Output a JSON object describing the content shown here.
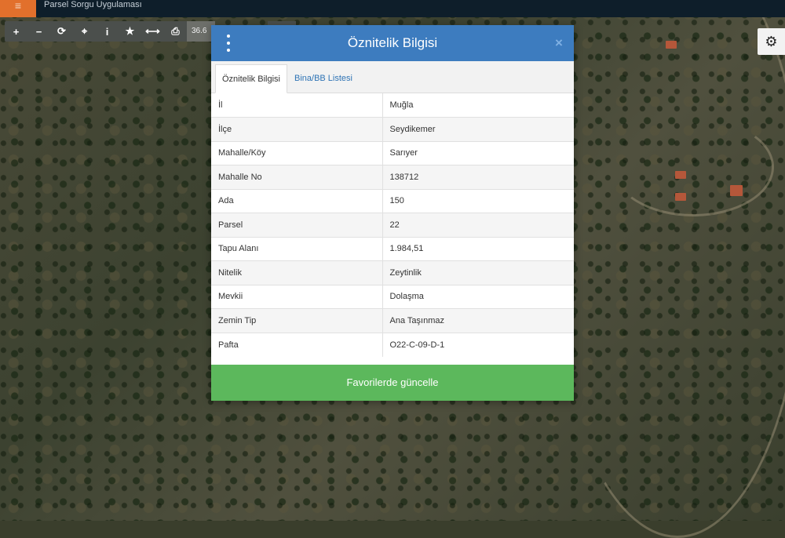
{
  "app": {
    "title": "Parsel Sorgu Uygulaması"
  },
  "toolbar": {
    "tools": [
      {
        "icon": "plus-icon",
        "glyph": "+"
      },
      {
        "icon": "minus-icon",
        "glyph": "−"
      },
      {
        "icon": "refresh-icon",
        "glyph": "⟳"
      },
      {
        "icon": "crosshair-icon",
        "glyph": "⌖"
      },
      {
        "icon": "info-icon",
        "glyph": "i"
      },
      {
        "icon": "star-icon",
        "glyph": "★"
      },
      {
        "icon": "measure-icon",
        "glyph": "⟷"
      },
      {
        "icon": "print-icon",
        "glyph": "⎙"
      }
    ],
    "coordinate": "36.6"
  },
  "modal": {
    "title": "Öznitelik Bilgisi",
    "tabs": [
      {
        "label": "Öznitelik Bilgisi",
        "active": true
      },
      {
        "label": "Bina/BB Listesi",
        "active": false
      }
    ],
    "rows": [
      {
        "key": "İl",
        "value": "Muğla"
      },
      {
        "key": "İlçe",
        "value": "Seydikemer"
      },
      {
        "key": "Mahalle/Köy",
        "value": "Sarıyer"
      },
      {
        "key": "Mahalle No",
        "value": "138712"
      },
      {
        "key": "Ada",
        "value": "150"
      },
      {
        "key": "Parsel",
        "value": "22"
      },
      {
        "key": "Tapu Alanı",
        "value": "1.984,51"
      },
      {
        "key": "Nitelik",
        "value": "Zeytinlik"
      },
      {
        "key": "Mevkii",
        "value": "Dolaşma"
      },
      {
        "key": "Zemin Tip",
        "value": "Ana Taşınmaz"
      },
      {
        "key": "Pafta",
        "value": "O22-C-09-D-1"
      }
    ],
    "action_label": "Favorilerde güncelle"
  },
  "colors": {
    "header_blue": "#3d7cbf",
    "action_green": "#5cb85c",
    "menu_orange": "#e2702c"
  }
}
